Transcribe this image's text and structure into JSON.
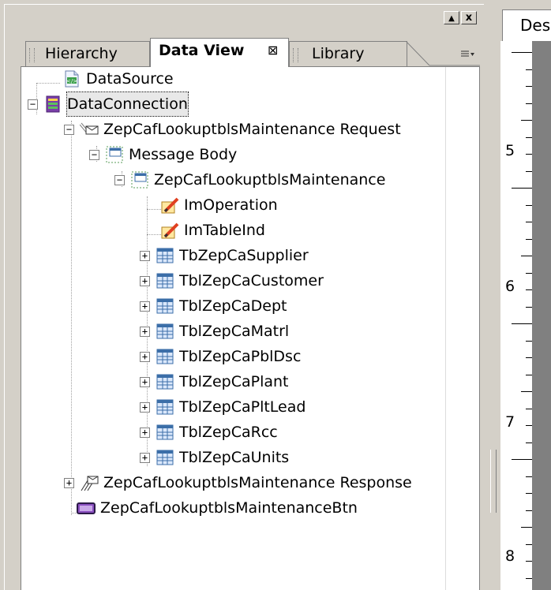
{
  "panel": {
    "buttons": {
      "collapse": "▲",
      "close": "x"
    },
    "tabs": [
      {
        "label": "Hierarchy",
        "active": false
      },
      {
        "label": "Data View",
        "active": true,
        "close": "⊠"
      },
      {
        "label": "Library",
        "active": false
      }
    ],
    "menu_icon": "menu-icon"
  },
  "tree": {
    "nodes": [
      {
        "label": "DataSource",
        "icon": "xml-document-icon"
      },
      {
        "label": "DataConnection",
        "icon": "data-connection-icon",
        "selected": true,
        "expander": "−"
      },
      {
        "label": "ZepCafLookuptblsMaintenance Request",
        "icon": "envelope-icon",
        "expander": "−"
      },
      {
        "label": "Message Body",
        "icon": "message-body-icon",
        "expander": "−"
      },
      {
        "label": "ZepCafLookuptblsMaintenance",
        "icon": "message-body-icon",
        "expander": "−"
      },
      {
        "label": "ImOperation",
        "icon": "field-edit-icon"
      },
      {
        "label": "ImTableInd",
        "icon": "field-edit-icon"
      },
      {
        "label": "TbZepCaSupplier",
        "icon": "table-icon",
        "expander": "+"
      },
      {
        "label": "TblZepCaCustomer",
        "icon": "table-icon",
        "expander": "+"
      },
      {
        "label": "TblZepCaDept",
        "icon": "table-icon",
        "expander": "+"
      },
      {
        "label": "TblZepCaMatrl",
        "icon": "table-icon",
        "expander": "+"
      },
      {
        "label": "TblZepCaPblDsc",
        "icon": "table-icon",
        "expander": "+"
      },
      {
        "label": "TblZepCaPlant",
        "icon": "table-icon",
        "expander": "+"
      },
      {
        "label": "TblZepCaPltLead",
        "icon": "table-icon",
        "expander": "+"
      },
      {
        "label": "TblZepCaRcc",
        "icon": "table-icon",
        "expander": "+"
      },
      {
        "label": "TblZepCaUnits",
        "icon": "table-icon",
        "expander": "+"
      },
      {
        "label": "ZepCafLookuptblsMaintenance Response",
        "icon": "envelope-response-icon",
        "expander": "+"
      },
      {
        "label": "ZepCafLookuptblsMaintenanceBtn",
        "icon": "button-control-icon"
      }
    ]
  },
  "right_pane": {
    "tab_label": "Des",
    "ruler_numbers": [
      "5",
      "6",
      "7",
      "8"
    ]
  }
}
